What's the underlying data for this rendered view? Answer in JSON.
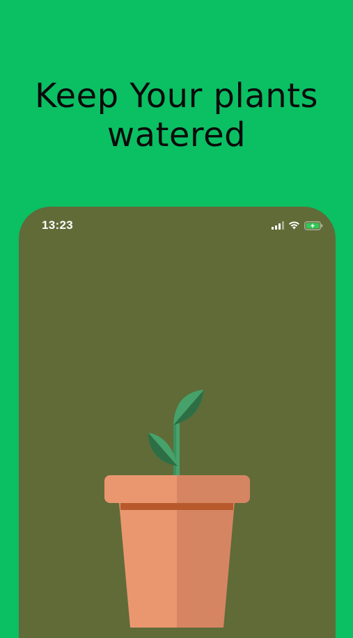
{
  "headline": {
    "line1": "Keep Your plants",
    "line2": "watered"
  },
  "phone": {
    "status_bar": {
      "time": "13:23",
      "icons": [
        "cellular-signal-icon",
        "wifi-icon",
        "battery-charging-icon"
      ]
    },
    "background_color": "#606b38",
    "illustration": "potted-plant-illustration"
  },
  "colors": {
    "background": "#0bbf63",
    "headline_text": "#0b0b0b",
    "pot_light": "#ea9770",
    "pot_dark": "#d68562",
    "pot_band": "#b8592c",
    "leaf_light": "#46a26a",
    "leaf_dark": "#2d6e45",
    "battery_green": "#34c759"
  }
}
